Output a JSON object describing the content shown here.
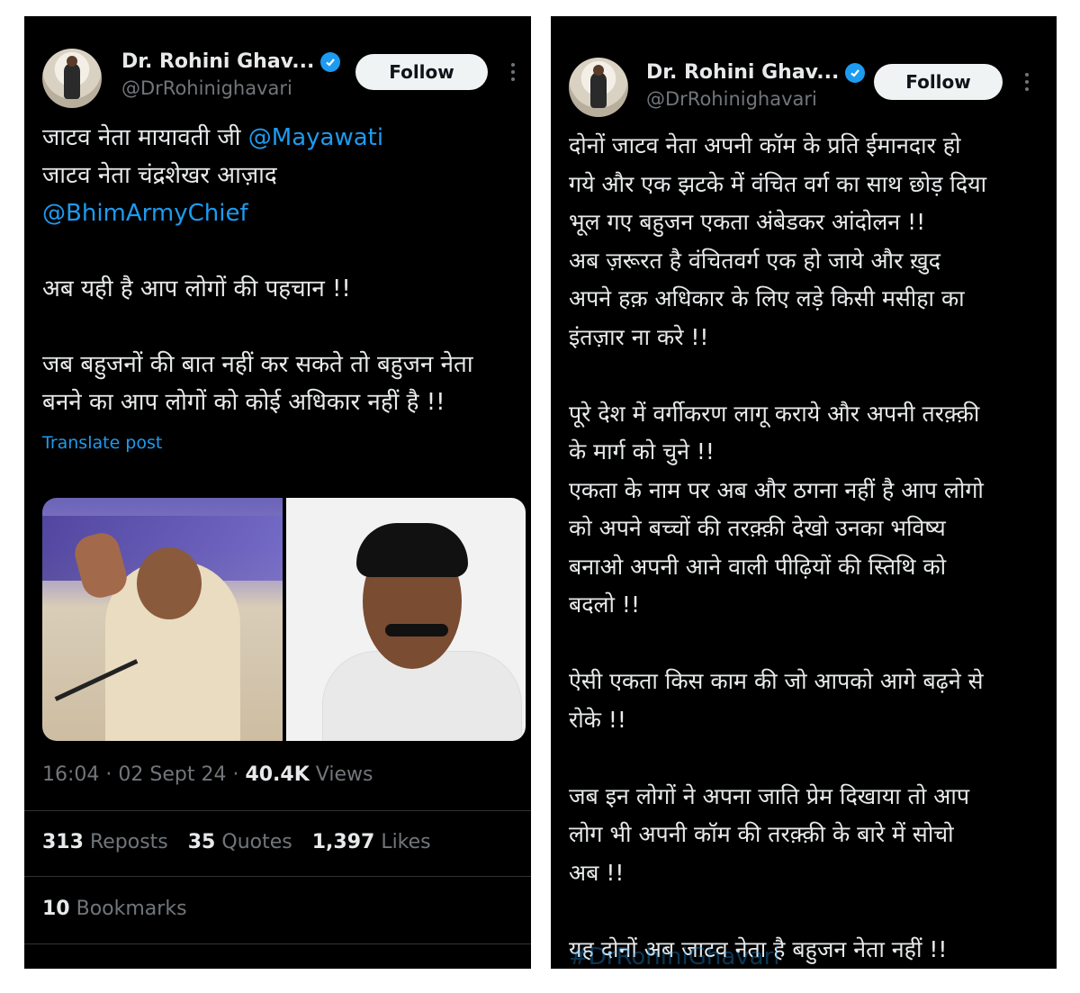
{
  "left": {
    "author": {
      "name": "Dr. Rohini Ghav...",
      "handle": "@DrRohinighavari"
    },
    "follow_label": "Follow",
    "text": {
      "line1": "जाटव नेता मायावती जी ",
      "mention1": "@Mayawati",
      "line2": "जाटव नेता चंद्रशेखर आज़ाद",
      "mention2": "@BhimArmyChief",
      "para2": "अब यही है आप लोगों की पहचान !!",
      "para3": "जब बहुजनों की बात नहीं कर सकते तो बहुजन नेता\nबनने का आप लोगों को कोई अधिकार नहीं है !!"
    },
    "translate_label": "Translate post",
    "meta": {
      "time": "16:04 · 02 Sept 24 · ",
      "views_count": "40.4K",
      "views_label": " Views"
    },
    "stats": {
      "reposts_count": "313",
      "reposts_label": "Reposts",
      "quotes_count": "35",
      "quotes_label": "Quotes",
      "likes_count": "1,397",
      "likes_label": "Likes",
      "bookmarks_count": "10",
      "bookmarks_label": "Bookmarks"
    }
  },
  "right": {
    "author": {
      "name": "Dr. Rohini Ghav...",
      "handle": "@DrRohinighavari"
    },
    "follow_label": "Follow",
    "text": "दोनों जाटव नेता अपनी कॉम के प्रति ईमानदार हो\nगये और एक झटके में वंचित वर्ग का साथ छोड़ दिया\nभूल गए बहुजन एकता अंबेडकर आंदोलन !!\nअब ज़रूरत है वंचितवर्ग एक हो जाये और ख़ुद\nअपने हक़ अधिकार के लिए लड़े किसी मसीहा का\nइंतज़ार ना करे !!\n\nपूरे देश में वर्गीकरण लागू कराये और अपनी तरक़्क़ी\nके मार्ग को चुने !!\nएकता के नाम पर अब और ठगना नहीं है आप लोगो\nको अपने बच्चों की तरक़्क़ी देखो उनका भविष्य\nबनाओ अपनी आने वाली पीढ़ियों की स्तिथि को\nबदलो !!\n\nऐसी एकता किस काम की जो आपको आगे बढ़ने से\nरोके !!\n\nजब इन लोगों ने अपना जाति प्रेम दिखाया तो आप\nलोग भी अपनी कॉम की तरक़्क़ी के बारे में सोचो\nअब !!\n\nयह दोनों अब जाटव नेता है बहुजन नेता नहीं !!",
    "faded_hashtag": "#DrRohiniGhavari"
  },
  "colors": {
    "accent": "#1d9bf0",
    "background": "#000000",
    "text": "#e7e9ea",
    "muted": "#71767b"
  }
}
